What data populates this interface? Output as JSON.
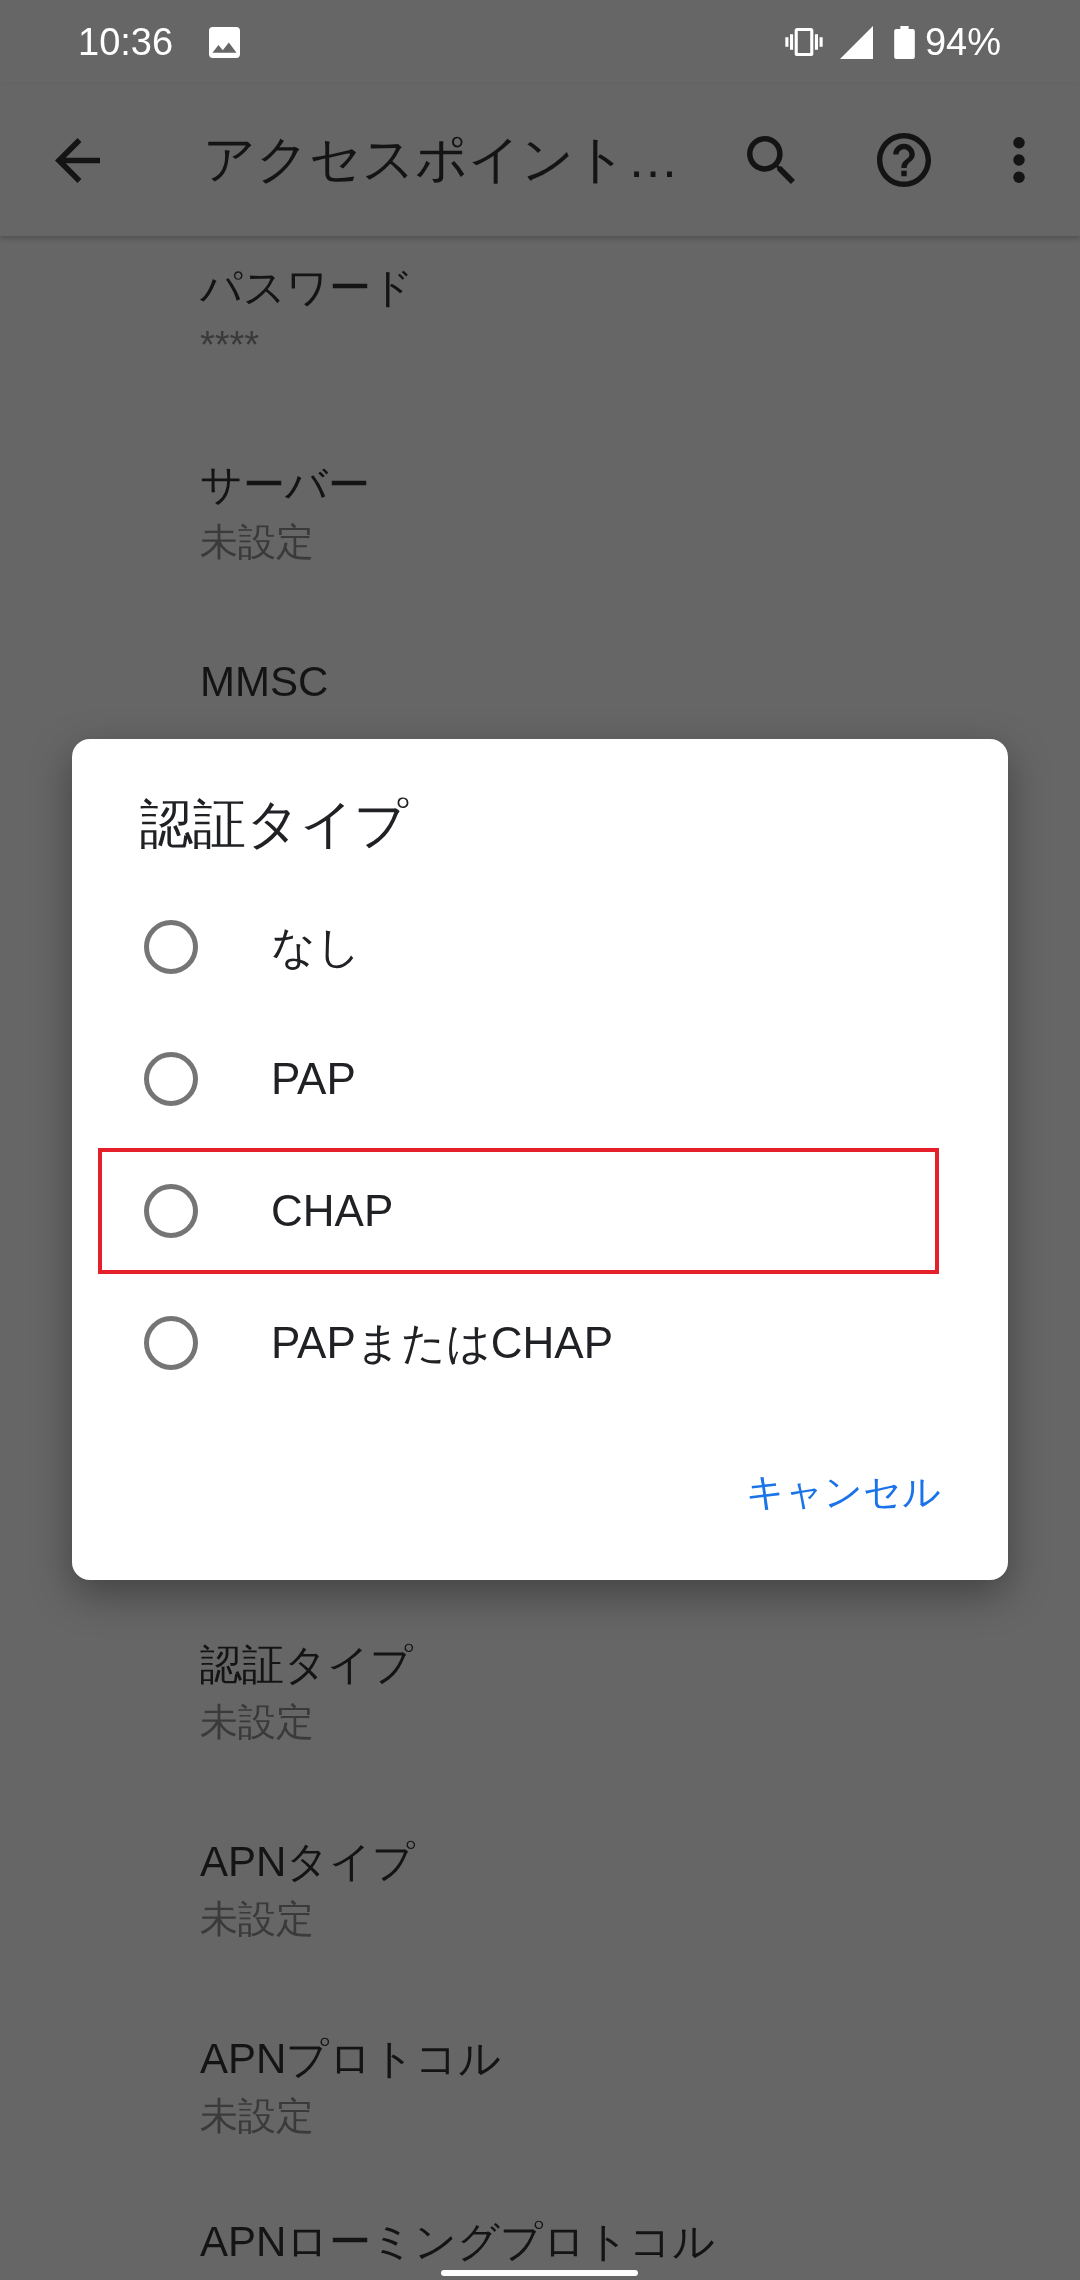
{
  "status_bar": {
    "time": "10:36",
    "battery": "94%"
  },
  "app_bar": {
    "title": "アクセスポイント…"
  },
  "settings_above_dialog": [
    {
      "title": "パスワード",
      "summary": "****"
    },
    {
      "title": "サーバー",
      "summary": "未設定"
    },
    {
      "title": "MMSC"
    }
  ],
  "settings_below_dialog": [
    {
      "title": "認証タイプ",
      "summary": "未設定"
    },
    {
      "title": "APNタイプ",
      "summary": "未設定"
    },
    {
      "title": "APNプロトコル",
      "summary": "未設定"
    },
    {
      "title": "APNローミングプロトコル"
    }
  ],
  "dialog": {
    "title": "認証タイプ",
    "options": [
      {
        "label": "なし",
        "selected": false,
        "highlighted": false
      },
      {
        "label": "PAP",
        "selected": false,
        "highlighted": false
      },
      {
        "label": "CHAP",
        "selected": false,
        "highlighted": true
      },
      {
        "label": "PAPまたはCHAP",
        "selected": false,
        "highlighted": false
      }
    ],
    "cancel": "キャンセル"
  }
}
